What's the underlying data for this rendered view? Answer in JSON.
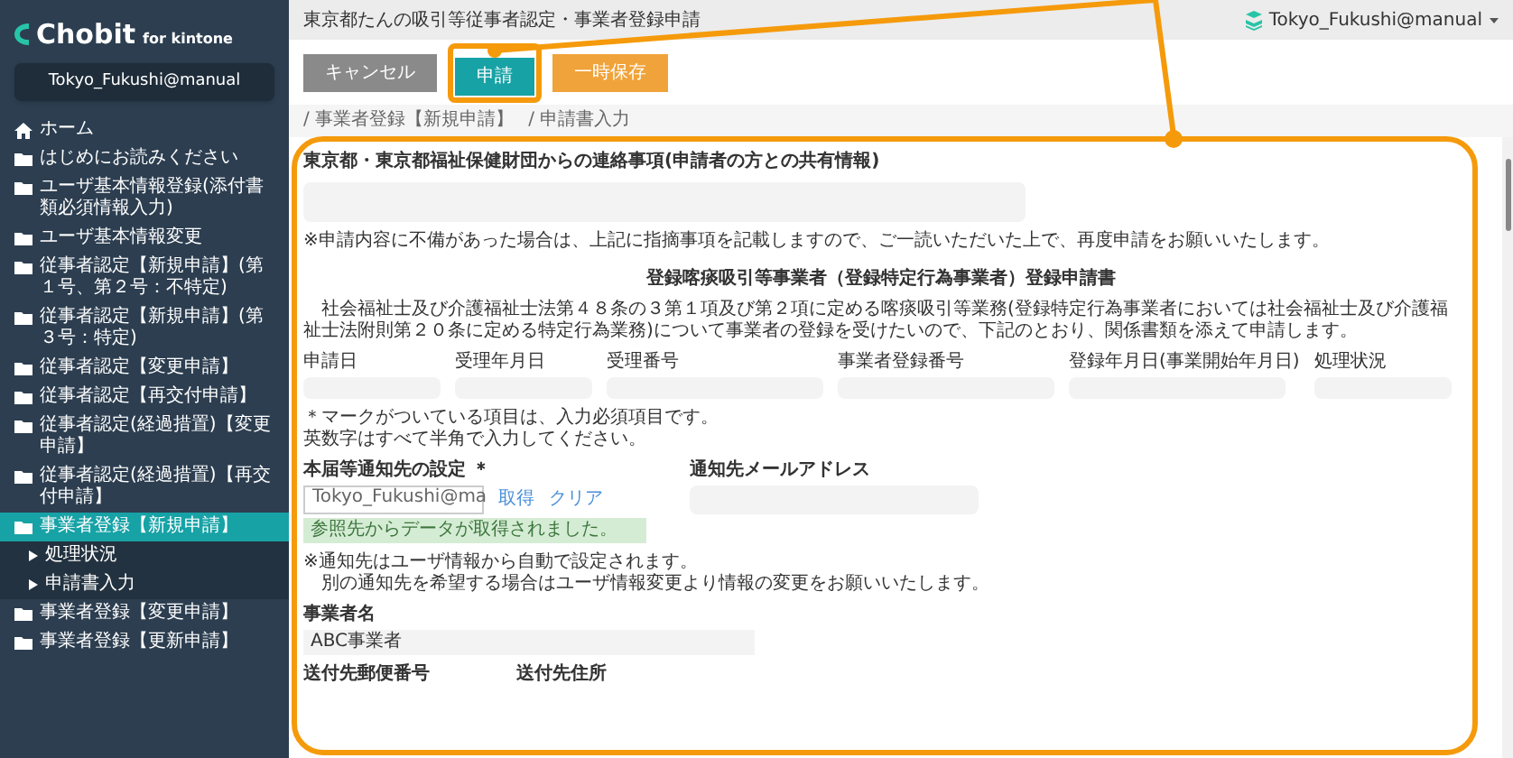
{
  "sidebar": {
    "logo": {
      "name": "Chobit",
      "suffix": "for kintone"
    },
    "user": "Tokyo_Fukushi@manual",
    "items": [
      {
        "kind": "home",
        "label": "ホーム",
        "selected": false
      },
      {
        "kind": "folder",
        "label": "はじめにお読みください",
        "selected": false
      },
      {
        "kind": "folder",
        "label": "ユーザ基本情報登録(添付書類必須情報入力)",
        "selected": false
      },
      {
        "kind": "folder",
        "label": "ユーザ基本情報変更",
        "selected": false
      },
      {
        "kind": "folder",
        "label": "従事者認定【新規申請】(第１号、第２号：不特定)",
        "selected": false
      },
      {
        "kind": "folder",
        "label": "従事者認定【新規申請】(第３号：特定)",
        "selected": false
      },
      {
        "kind": "folder",
        "label": "従事者認定【変更申請】",
        "selected": false
      },
      {
        "kind": "folder",
        "label": "従事者認定【再交付申請】",
        "selected": false
      },
      {
        "kind": "folder",
        "label": "従事者認定(経過措置)【変更申請】",
        "selected": false
      },
      {
        "kind": "folder",
        "label": "従事者認定(経過措置)【再交付申請】",
        "selected": false
      },
      {
        "kind": "folder",
        "label": "事業者登録【新規申請】",
        "selected": true,
        "children": [
          {
            "label": "処理状況"
          },
          {
            "label": "申請書入力"
          }
        ]
      },
      {
        "kind": "folder",
        "label": "事業者登録【変更申請】",
        "selected": false
      },
      {
        "kind": "folder",
        "label": "事業者登録【更新申請】",
        "selected": false
      }
    ]
  },
  "header": {
    "title": "東京都たんの吸引等従事者認定・事業者登録申請",
    "user": "Tokyo_Fukushi@manual"
  },
  "buttons": [
    {
      "kind": "cancel",
      "label": "キャンセル"
    },
    {
      "kind": "submit",
      "label": "申請"
    },
    {
      "kind": "save",
      "label": "一時保存"
    }
  ],
  "breadcrumb": [
    "/ 事業者登録【新規申請】",
    "/ 申請書入力"
  ],
  "form": {
    "message_label": "東京都・東京都福祉保健財団からの連絡事項(申請者の方との共有情報)",
    "message_note": "※申請内容に不備があった場合は、上記に指摘事項を記載しますので、ご一読いただいた上で、再度申請をお願いいたします。",
    "title": "登録喀痰吸引等事業者（登録特定行為事業者）登録申請書",
    "intro": "社会福祉士及び介護福祉士法第４８条の３第１項及び第２項に定める喀痰吸引等業務(登録特定行為事業者においては社会福祉士及び介護福祉士法附則第２０条に定める特定行為業務)について事業者の登録を受けたいので、下記のとおり、関係書類を添えて申請します。",
    "status_fields": [
      {
        "label": "申請日"
      },
      {
        "label": "受理年月日"
      },
      {
        "label": "受理番号"
      },
      {
        "label": "事業者登録番号"
      },
      {
        "label": "登録年月日(事業開始年月日)"
      },
      {
        "label": "処理状況"
      }
    ],
    "required_note": [
      "＊マークがついている項目は、入力必須項目です。",
      "英数字はすべて半角で入力してください。"
    ],
    "notify": {
      "label": "本届等通知先の設定 ＊",
      "value": "Tokyo_Fukushi@ma",
      "links": [
        "取得",
        "クリア"
      ],
      "success": "参照先からデータが取得されました。",
      "email_label": "通知先メールアドレス"
    },
    "notify_note": [
      "※通知先はユーザ情報から自動で設定されます。",
      "別の通知先を希望する場合はユーザ情報変更より情報の変更をお願いいたします。"
    ],
    "company": {
      "label": "事業者名",
      "value": "ABC事業者"
    },
    "bottom_labels": [
      "送付先郵便番号",
      "送付先住所"
    ]
  }
}
